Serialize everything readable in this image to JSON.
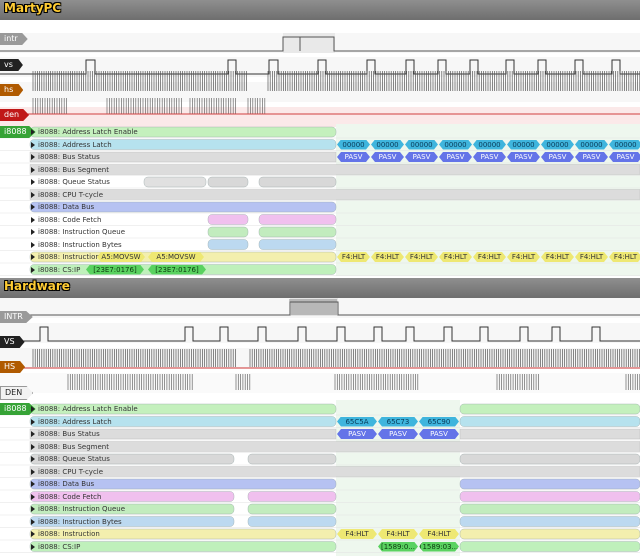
{
  "colors": {
    "latch_enable": "#c4f0bd",
    "addr": "#b6e2ee",
    "addr_val": "#3fb5dd",
    "status": "#cfcfcf",
    "status_val": "#6474e8",
    "data_bus": "#b6c2f2",
    "code_fetch": "#f0c0ee",
    "queue": "#c2ecbe",
    "bytes": "#bcd9f0",
    "instruction": "#f3efae",
    "instr_val": "#eee873",
    "csip": "#bff0bb",
    "csip_val": "#5ad260"
  },
  "top": {
    "title": "MartyPC",
    "signals": [
      {
        "label": "intr",
        "color": "#9a9a9a"
      },
      {
        "label": "vs",
        "color": "#222222"
      },
      {
        "label": "hs",
        "color": "#b05a00"
      },
      {
        "label": "den",
        "color": "#c01818"
      }
    ],
    "group": "i8088",
    "rows": [
      "i8088: Address Latch Enable",
      "i8088: Address Latch",
      "i8088: Bus Status",
      "i8088: Bus Segment",
      "i8088: Queue Status",
      "i8088: CPU T-cycle",
      "i8088: Data Bus",
      "i8088: Code Fetch",
      "i8088: Instruction Queue",
      "i8088: Instruction Bytes",
      "i8088: Instruction",
      "i8088: CS:IP"
    ],
    "addr_values": [
      "00000",
      "00000",
      "00000",
      "00000",
      "00000",
      "00000",
      "00000",
      "00000",
      "00000"
    ],
    "status_values": [
      "PASV",
      "PASV",
      "PASV",
      "PASV",
      "PASV",
      "PASV",
      "PASV",
      "PASV",
      "PASV"
    ],
    "instr_values": [
      "A5:MOVSW",
      "A5:MOVSW",
      "F4:HLT",
      "F4:HLT",
      "F4:HLT",
      "F4:HLT",
      "F4:HLT",
      "F4:HLT",
      "F4:HLT",
      "F4:HLT",
      "F4:HLT"
    ],
    "csip_values": [
      "[23E7:0176]",
      "[23E7:0176]"
    ]
  },
  "bottom": {
    "title": "Hardware",
    "signals": [
      {
        "label": "INTR",
        "color": "#9a9a9a"
      },
      {
        "label": "VS",
        "color": "#222222"
      },
      {
        "label": "HS",
        "color": "#b05a00"
      },
      {
        "label": "DEN",
        "color": "#f2f2f2"
      }
    ],
    "group": "i8088",
    "rows": [
      "i8088: Address Latch Enable",
      "i8088: Address Latch",
      "i8088: Bus Status",
      "i8088: Bus Segment",
      "i8088: Queue Status",
      "i8088: CPU T-cycle",
      "i8088: Data Bus",
      "i8088: Code Fetch",
      "i8088: Instruction Queue",
      "i8088: Instruction Bytes",
      "i8088: Instruction",
      "i8088: CS:IP"
    ],
    "addr_values": [
      "65C5A",
      "65C73",
      "65C90"
    ],
    "status_values": [
      "PASV",
      "PASV",
      "PASV"
    ],
    "instr_values": [
      "F4:HLT",
      "F4:HLT",
      "F4:HLT"
    ],
    "csip_values": [
      "[1589:0...",
      "[1589:03..."
    ]
  }
}
